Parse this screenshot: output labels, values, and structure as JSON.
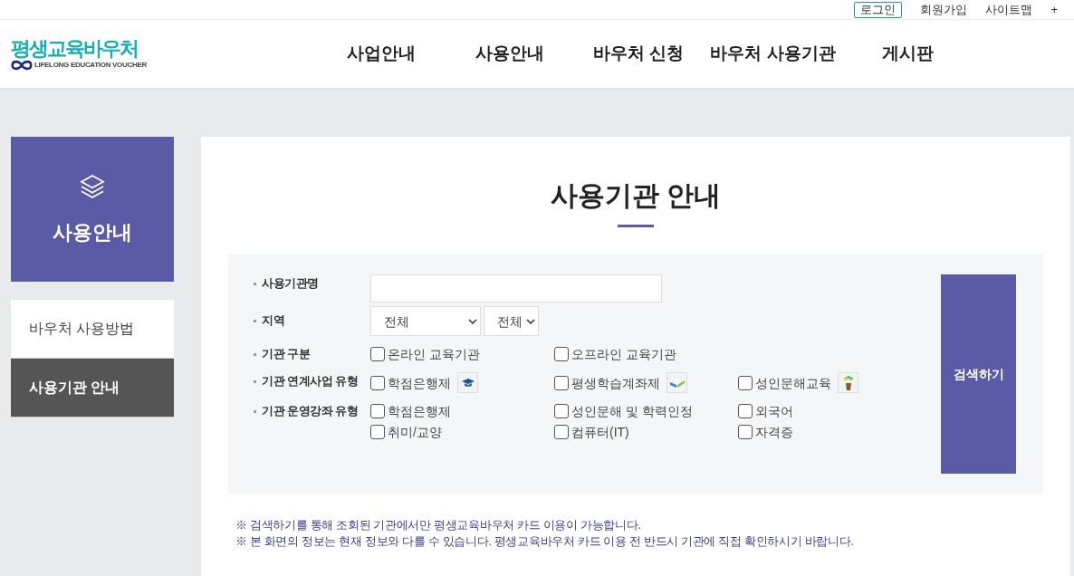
{
  "utility_links": [
    {
      "label": "로그인",
      "kind": "boxed"
    },
    {
      "label": "회원가입",
      "kind": "plain"
    },
    {
      "label": "사이트맵",
      "kind": "plain"
    },
    {
      "label": "+",
      "kind": "plain"
    }
  ],
  "logo": {
    "title": "평생교육바우처",
    "subtitle": "LIFELONG EDUCATION VOUCHER"
  },
  "nav": [
    "사업안내",
    "사용안내",
    "바우처 신청",
    "바우처 사용기관",
    "게시판"
  ],
  "sidebar": {
    "title": "사용안내",
    "items": [
      {
        "label": "바우처 사용방법",
        "selected": false
      },
      {
        "label": "사용기관 안내",
        "selected": true
      }
    ]
  },
  "page_title": "사용기관 안내",
  "filters": [
    {
      "label": "사용기관명",
      "kind": "text"
    },
    {
      "label": "지역",
      "kind": "select",
      "selects": [
        "전체",
        "전체"
      ]
    },
    {
      "label": "기관 구분",
      "kind": "checkbox",
      "options": [
        {
          "label": "온라인 교육기관",
          "checked": false
        },
        {
          "label": "오프라인 교육기관",
          "checked": false
        }
      ]
    },
    {
      "label": "기관 연계사업 유형",
      "kind": "badged",
      "options": [
        {
          "label": "학점은행제",
          "checked": false
        },
        {
          "label": "평생학습계좌제",
          "checked": false
        },
        {
          "label": "성인문해교육",
          "checked": false
        }
      ]
    },
    {
      "label": "기관 운영강좌 유형",
      "kind": "checkbox",
      "options": [
        {
          "label": "학점은행제",
          "checked": false
        },
        {
          "label": "성인문해 및 학력인정",
          "checked": false
        },
        {
          "label": "외국어",
          "checked": false
        },
        {
          "label": "취미/교양",
          "checked": false
        },
        {
          "label": "컴퓨터(IT)",
          "checked": false
        },
        {
          "label": "자격증",
          "checked": false
        }
      ]
    }
  ],
  "search_button": "검색하기",
  "notes": [
    "※ 검색하기를 통해 조회된 기관에서만 평생교육바우처 카드 이용이 가능합니다.",
    "※ 본 화면의 정보는 현재 정보와 다를 수 있습니다. 평생교육바우처 카드 이용 전 반드시 기관에 직접 확인하시기 바랍니다."
  ]
}
